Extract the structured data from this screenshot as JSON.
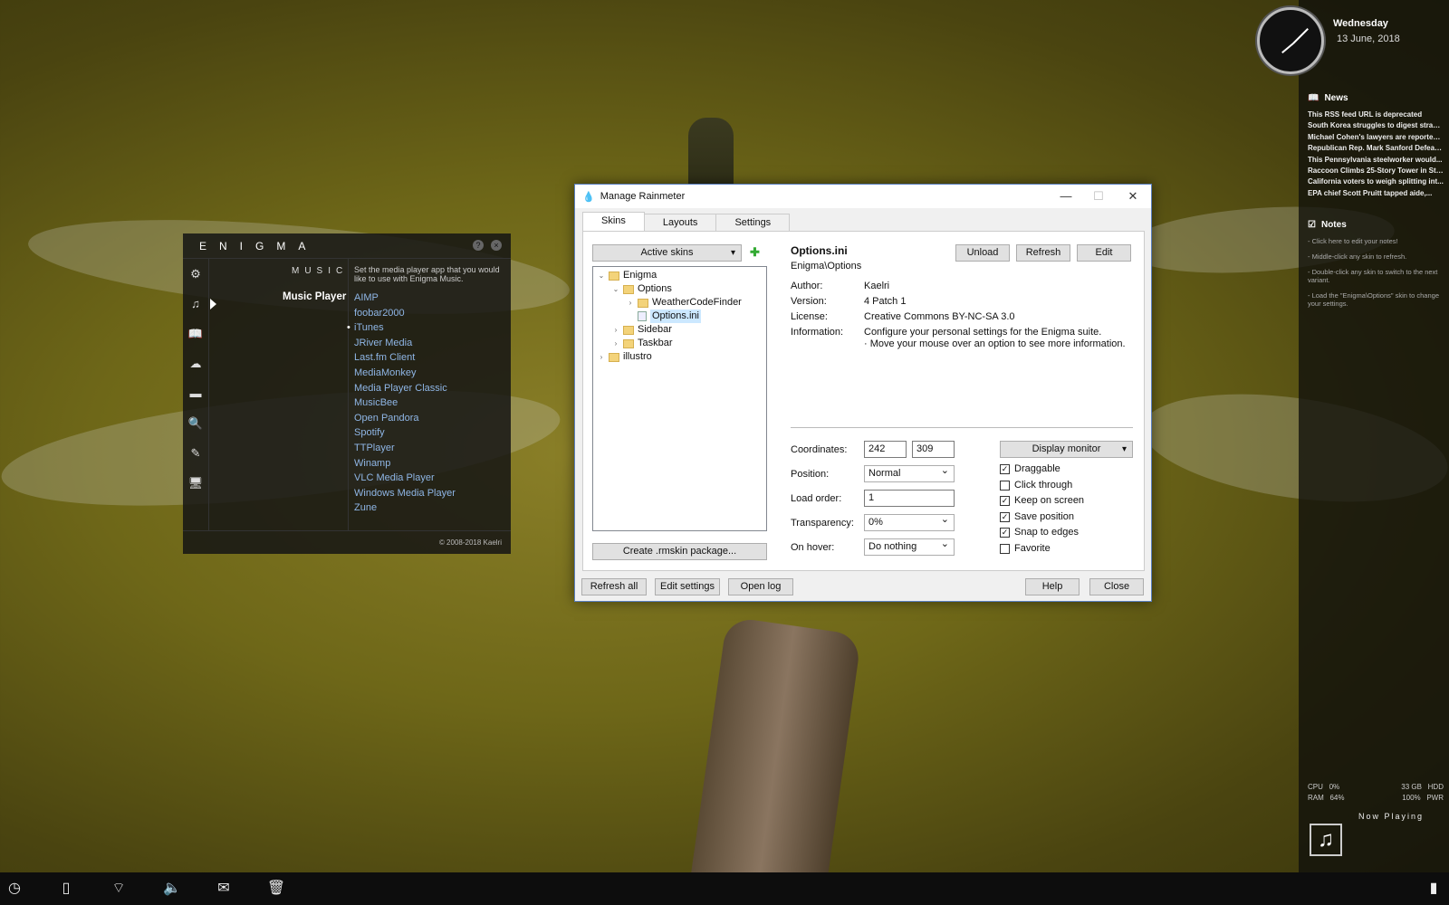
{
  "rightbar": {
    "day": "Wednesday",
    "date": "13 June, 2018",
    "news_title": "News",
    "news": [
      "This RSS feed URL is deprecated",
      "South Korea struggles to digest strange...",
      "Michael Cohen's lawyers are reportedly...",
      "Republican Rep. Mark Sanford Defeate...",
      "This Pennsylvania steelworker would...",
      "Raccoon Climbs 25-Story Tower in St....",
      "California voters to weigh splitting int...",
      "EPA chief Scott Pruitt tapped aide,..."
    ],
    "notes_title": "Notes",
    "notes": [
      "- Click here to edit your notes!",
      "- Middle-click any skin to refresh.",
      "- Double-click any skin to switch to the next variant.",
      "- Load the \"Enigma\\Options\" skin to change your settings."
    ],
    "stats": {
      "cpu_label": "CPU",
      "cpu": "0%",
      "ram_label": "RAM",
      "ram": "64%",
      "hdd": "33 GB",
      "hdd_label": "HDD",
      "pwr": "100%",
      "pwr_label": "PWR"
    },
    "now_playing": "Now Playing"
  },
  "enigma": {
    "title": "ENIGMA",
    "section": "MUSIC",
    "description": "Set the media player app that you would like to use with Enigma Music.",
    "label": "Music Player",
    "players": [
      "AIMP",
      "foobar2000",
      "iTunes",
      "JRiver Media",
      "Last.fm Client",
      "MediaMonkey",
      "Media Player Classic",
      "MusicBee",
      "Open Pandora",
      "Spotify",
      "TTPlayer",
      "Winamp",
      "VLC Media Player",
      "Windows Media Player",
      "Zune"
    ],
    "selected": "iTunes",
    "footer": "© 2008-2018 Kaelri"
  },
  "dialog": {
    "title": "Manage Rainmeter",
    "tabs": [
      "Skins",
      "Layouts",
      "Settings"
    ],
    "active_tab": "Skins",
    "active_skins_label": "Active skins",
    "tree": {
      "enigma": "Enigma",
      "options": "Options",
      "weather": "WeatherCodeFinder",
      "options_ini": "Options.ini",
      "sidebar": "Sidebar",
      "taskbar": "Taskbar",
      "illustro": "illustro"
    },
    "create_package": "Create .rmskin package...",
    "skin_title": "Options.ini",
    "skin_path": "Enigma\\Options",
    "unload": "Unload",
    "refresh": "Refresh",
    "edit": "Edit",
    "author_label": "Author:",
    "author": "Kaelri",
    "version_label": "Version:",
    "version": "4 Patch 1",
    "license_label": "License:",
    "license": "Creative Commons BY-NC-SA 3.0",
    "info_label": "Information:",
    "info_line1": "Configure your personal settings for the Enigma suite.",
    "info_line2": "· Move your mouse over an option to see more information.",
    "coords_label": "Coordinates:",
    "coord_x": "242",
    "coord_y": "309",
    "display_monitor": "Display monitor",
    "position_label": "Position:",
    "position": "Normal",
    "load_order_label": "Load order:",
    "load_order": "1",
    "transparency_label": "Transparency:",
    "transparency": "0%",
    "on_hover_label": "On hover:",
    "on_hover": "Do nothing",
    "checks": [
      {
        "label": "Draggable",
        "checked": true
      },
      {
        "label": "Click through",
        "checked": false
      },
      {
        "label": "Keep on screen",
        "checked": true
      },
      {
        "label": "Save position",
        "checked": true
      },
      {
        "label": "Snap to edges",
        "checked": true
      },
      {
        "label": "Favorite",
        "checked": false
      }
    ],
    "refresh_all": "Refresh all",
    "edit_settings": "Edit settings",
    "open_log": "Open log",
    "help": "Help",
    "close": "Close"
  }
}
